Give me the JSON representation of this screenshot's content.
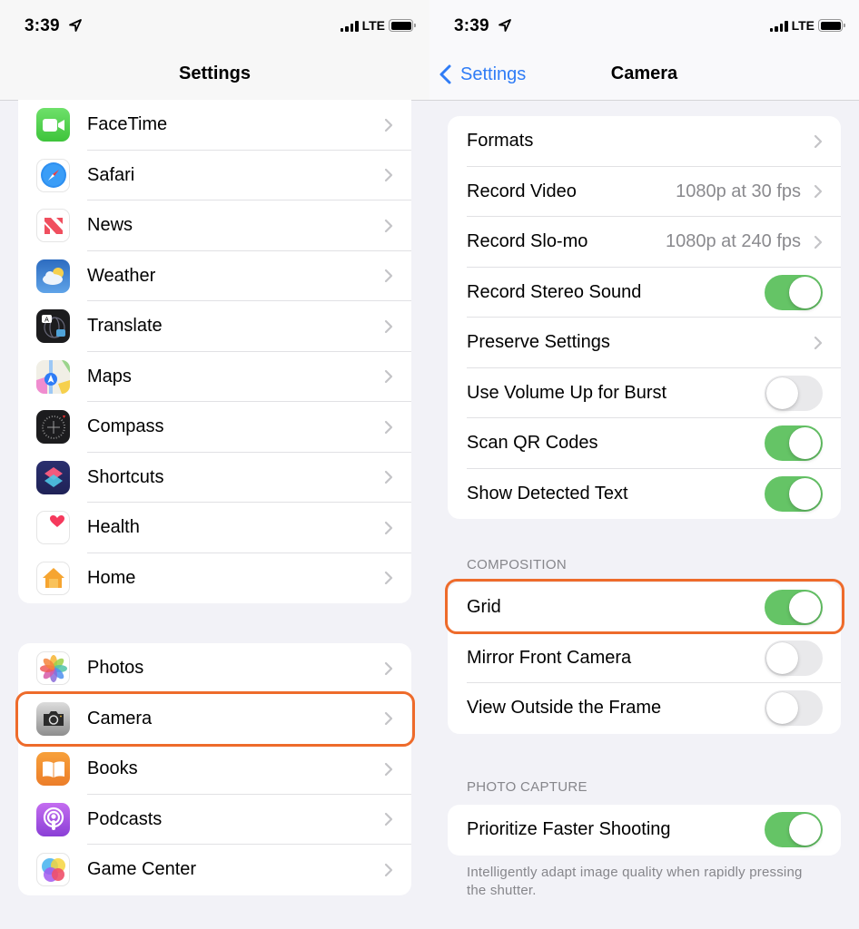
{
  "left_screen": {
    "status": {
      "time": "3:39",
      "network": "LTE"
    },
    "nav_title": "Settings",
    "group1": [
      {
        "label": "FaceTime",
        "icon": "facetime-icon"
      },
      {
        "label": "Safari",
        "icon": "safari-icon"
      },
      {
        "label": "News",
        "icon": "news-icon"
      },
      {
        "label": "Weather",
        "icon": "weather-icon"
      },
      {
        "label": "Translate",
        "icon": "translate-icon"
      },
      {
        "label": "Maps",
        "icon": "maps-icon"
      },
      {
        "label": "Compass",
        "icon": "compass-icon"
      },
      {
        "label": "Shortcuts",
        "icon": "shortcuts-icon"
      },
      {
        "label": "Health",
        "icon": "health-icon"
      },
      {
        "label": "Home",
        "icon": "home-icon"
      }
    ],
    "group2": [
      {
        "label": "Photos",
        "icon": "photos-icon"
      },
      {
        "label": "Camera",
        "icon": "camera-icon",
        "highlighted": true
      },
      {
        "label": "Books",
        "icon": "books-icon"
      },
      {
        "label": "Podcasts",
        "icon": "podcasts-icon"
      },
      {
        "label": "Game Center",
        "icon": "game-center-icon"
      }
    ]
  },
  "right_screen": {
    "status": {
      "time": "3:39",
      "network": "LTE"
    },
    "back_label": "Settings",
    "nav_title": "Camera",
    "group1": [
      {
        "label": "Formats",
        "type": "link"
      },
      {
        "label": "Record Video",
        "type": "link",
        "value": "1080p at 30 fps"
      },
      {
        "label": "Record Slo-mo",
        "type": "link",
        "value": "1080p at 240 fps"
      },
      {
        "label": "Record Stereo Sound",
        "type": "toggle",
        "on": true
      },
      {
        "label": "Preserve Settings",
        "type": "link"
      },
      {
        "label": "Use Volume Up for Burst",
        "type": "toggle",
        "on": false
      },
      {
        "label": "Scan QR Codes",
        "type": "toggle",
        "on": true
      },
      {
        "label": "Show Detected Text",
        "type": "toggle",
        "on": true
      }
    ],
    "composition": {
      "header": "COMPOSITION",
      "items": [
        {
          "label": "Grid",
          "type": "toggle",
          "on": true,
          "highlighted": true
        },
        {
          "label": "Mirror Front Camera",
          "type": "toggle",
          "on": false
        },
        {
          "label": "View Outside the Frame",
          "type": "toggle",
          "on": false
        }
      ]
    },
    "photo_capture": {
      "header": "PHOTO CAPTURE",
      "items": [
        {
          "label": "Prioritize Faster Shooting",
          "type": "toggle",
          "on": true
        }
      ],
      "footer": "Intelligently adapt image quality when rapidly pressing the shutter."
    }
  },
  "colors": {
    "accent_blue": "#2f7cf6",
    "toggle_on": "#65c466",
    "toggle_off": "#e9e9eb",
    "highlight": "#ee6b2b",
    "background": "#f2f2f7"
  }
}
